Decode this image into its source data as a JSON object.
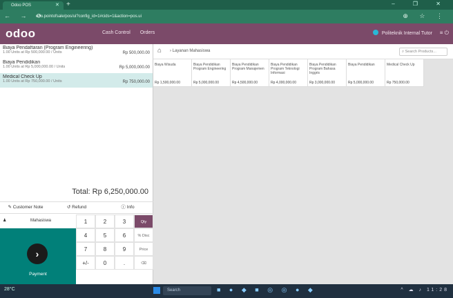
{
  "browser": {
    "tab_title": "Odoo POS",
    "url": "edu.pointofsale/pos/ui?config_id=1#cids=1&action=pos.ui",
    "nav_icons": "← → ⟳",
    "window_controls": "–  ❐  ✕",
    "ext_icons": "⊕ ☆ ⋮"
  },
  "odoo": {
    "logo": "odoo",
    "nav": [
      "Cash Control",
      "Orders"
    ],
    "user": "Politeknik Internal Tutor",
    "right_icons": "≡ ⏻"
  },
  "order": {
    "lines": [
      {
        "name": "Biaya Pendaftaran (Program Engineering)",
        "sub": "1.00 Units at Rp 500,000.00 / Units",
        "price": "Rp 500,000.00",
        "selected": false
      },
      {
        "name": "Biaya Pendidikan",
        "sub": "1.00 Units at Rp 5,000,000.00 / Units",
        "price": "Rp 5,000,000.00",
        "selected": false
      },
      {
        "name": "Medical Check Up",
        "sub": "1.00 Units at Rp 750,000.00 / Units",
        "price": "Rp 750,000.00",
        "selected": true
      }
    ],
    "total_label": "Total: Rp 6,250,000.00"
  },
  "controls": {
    "customer_note": "Customer Note",
    "refund": "Refund",
    "info": "Info"
  },
  "keypad": {
    "customer": "Mahasiswa",
    "payment": "Payment",
    "pay_icon": "›",
    "keys": [
      "1",
      "2",
      "3",
      "Qty",
      "4",
      "5",
      "6",
      "% Disc",
      "7",
      "8",
      "9",
      "Price",
      "+/-",
      "0",
      ".",
      "⌫"
    ]
  },
  "products": {
    "breadcrumb": "Layanan Mahasiswa",
    "search_placeholder": "Search Products...",
    "items": [
      {
        "title": "Biaya Wisuda",
        "price": "Rp 1,500,000.00"
      },
      {
        "title": "Biaya Pendidikan Program Engineering",
        "price": "Rp 5,000,000.00"
      },
      {
        "title": "Biaya Pendidikan Program Manajemen",
        "price": "Rp 4,500,000.00"
      },
      {
        "title": "Biaya Pendidikan Program Teknologi Informasi",
        "price": "Rp 4,000,000.00"
      },
      {
        "title": "Biaya Pendidikan Program Bahasa Inggris",
        "price": "Rp 3,000,000.00"
      },
      {
        "title": "Biaya Pendidikan",
        "price": "Rp 5,000,000.00"
      },
      {
        "title": "Medical Check Up",
        "price": "Rp 750,000.00"
      }
    ]
  },
  "taskbar": {
    "weather": "28°C",
    "search": "Search",
    "apps": "■ ● ◆ ■ ◎ ◎ ● ◆",
    "tray": "^ ☁ ♪ 11:28"
  }
}
